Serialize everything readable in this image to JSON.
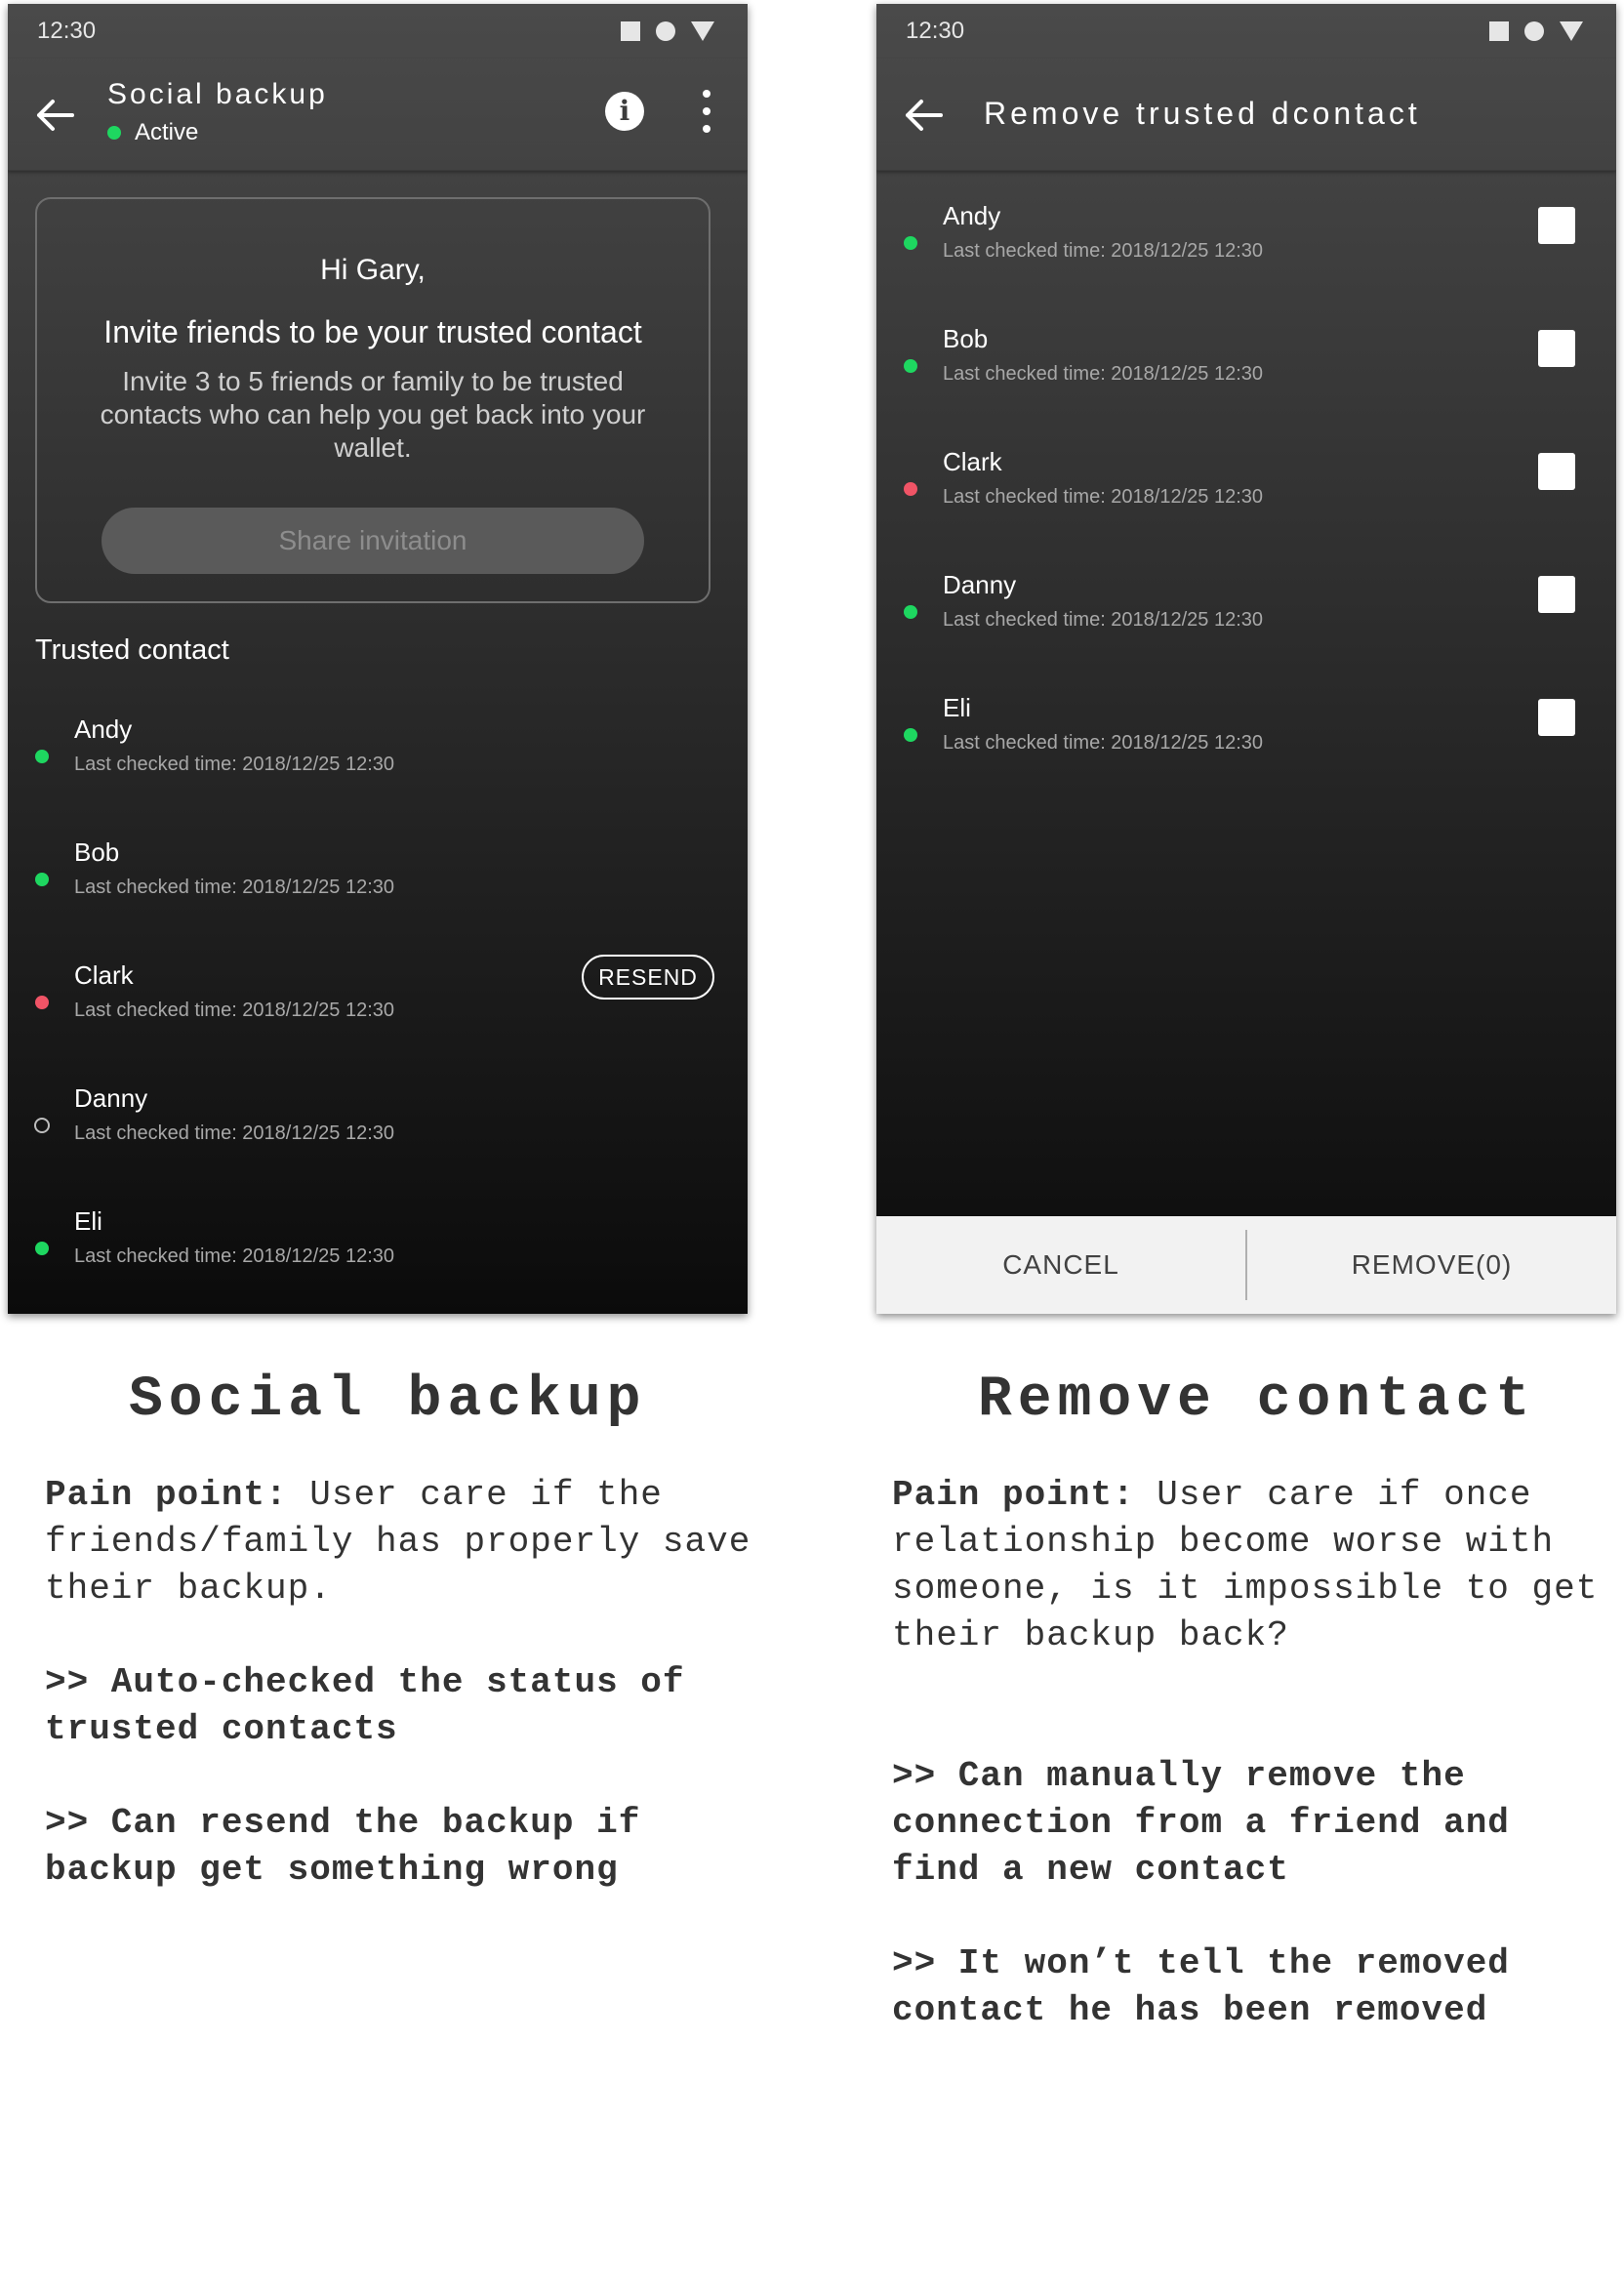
{
  "left_screen": {
    "status_time": "12:30",
    "title": "Social backup",
    "status": "Active",
    "greeting": "Hi Gary,",
    "invite_heading": "Invite friends to be your trusted contact",
    "invite_body": "Invite 3 to 5 friends or family to be trusted contacts who can help you get back into your wallet.",
    "share_button": "Share invitation",
    "section_title": "Trusted contact",
    "contacts": [
      {
        "name": "Andy",
        "time": "Last checked time: 2018/12/25 12:30",
        "status": "green"
      },
      {
        "name": "Bob",
        "time": "Last checked time: 2018/12/25 12:30",
        "status": "green"
      },
      {
        "name": "Clark",
        "time": "Last checked time: 2018/12/25 12:30",
        "status": "red"
      },
      {
        "name": "Danny",
        "time": "Last checked time: 2018/12/25 12:30",
        "status": "empty"
      },
      {
        "name": "Eli",
        "time": "Last checked time: 2018/12/25 12:30",
        "status": "green"
      }
    ],
    "resend_label": "RESEND"
  },
  "right_screen": {
    "status_time": "12:30",
    "title": "Remove trusted dcontact",
    "contacts": [
      {
        "name": "Andy",
        "time": "Last checked time: 2018/12/25 12:30",
        "status": "green"
      },
      {
        "name": "Bob",
        "time": "Last checked time: 2018/12/25 12:30",
        "status": "green"
      },
      {
        "name": "Clark",
        "time": "Last checked time: 2018/12/25 12:30",
        "status": "red"
      },
      {
        "name": "Danny",
        "time": "Last checked time: 2018/12/25 12:30",
        "status": "green"
      },
      {
        "name": "Eli",
        "time": "Last checked time: 2018/12/25 12:30",
        "status": "green"
      }
    ],
    "cancel_label": "CANCEL",
    "remove_label": "REMOVE(0)"
  },
  "captions": {
    "left": {
      "title": "Social backup",
      "pain_label": "Pain point:",
      "pain_text": "User care if the friends/family has properly save their backup.",
      "point1": ">> Auto-checked the status of trusted contacts",
      "point2": ">> Can resend the backup if backup get something wrong"
    },
    "right": {
      "title": "Remove contact",
      "pain_label": "Pain point:",
      "pain_text": "User care if once relationship become worse with someone, is it impossible to get their backup back?",
      "point1": ">> Can manually remove the connection from a friend and find a new contact",
      "point2": ">> It won’t tell the removed contact he has been removed"
    }
  },
  "colors": {
    "status_green": "#1ed760",
    "status_red": "#f05466",
    "bottom_bar": "#f2f2f2"
  }
}
